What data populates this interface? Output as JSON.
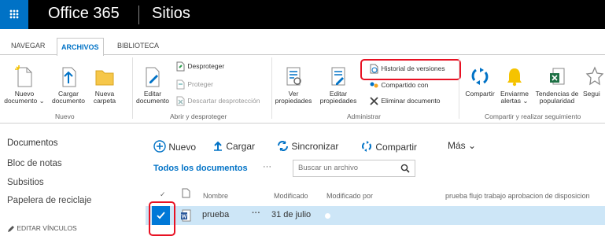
{
  "header": {
    "app_title": "Office 365",
    "site_title": "Sitios"
  },
  "tabs": [
    {
      "label": "NAVEGAR"
    },
    {
      "label": "ARCHIVOS"
    },
    {
      "label": "BIBLIOTECA"
    }
  ],
  "ribbon": {
    "nuevo": {
      "nuevo_documento": [
        "Nuevo",
        "documento ⌄"
      ],
      "cargar_documento": [
        "Cargar",
        "documento"
      ],
      "nueva_carpeta": [
        "Nueva",
        "carpeta"
      ],
      "group_label": "Nuevo"
    },
    "abrir": {
      "editar_documento": [
        "Editar",
        "documento"
      ],
      "desproteger": "Desproteger",
      "proteger": "Proteger",
      "descartar": "Descartar desprotección",
      "group_label": "Abrir y desproteger"
    },
    "administrar": {
      "ver_propiedades": [
        "Ver",
        "propiedades"
      ],
      "editar_propiedades": [
        "Editar",
        "propiedades"
      ],
      "historial": "Historial de versiones",
      "compartido": "Compartido con",
      "eliminar": "Eliminar documento",
      "group_label": "Administrar"
    },
    "compartir": {
      "compartir": "Compartir",
      "enviarme_alertas": [
        "Enviarme",
        "alertas ⌄"
      ],
      "tendencias": [
        "Tendencias de",
        "popularidad"
      ],
      "seguir": "Segui",
      "group_label": "Compartir y realizar seguimiento"
    }
  },
  "nav": {
    "items": [
      "Documentos",
      "Bloc de notas",
      "Subsitios",
      "Papelera de reciclaje"
    ],
    "edit_links": "EDITAR VÍNCULOS"
  },
  "commands": {
    "nuevo": "Nuevo",
    "cargar": "Cargar",
    "sincronizar": "Sincronizar",
    "compartir": "Compartir",
    "mas": "Más ⌄"
  },
  "views": {
    "all_docs": "Todos los documentos",
    "more": "···"
  },
  "search": {
    "placeholder": "Buscar un archivo"
  },
  "list": {
    "columns": [
      "Nombre",
      "Modificado",
      "Modificado por",
      "prueba flujo trabajo aprobacion de disposicion"
    ],
    "rows": [
      {
        "name": "prueba",
        "modified": "31 de julio",
        "menu": "···"
      }
    ]
  },
  "colors": {
    "accent": "#0072c6",
    "highlight": "#e81123",
    "selected_row": "#cde6f7"
  }
}
